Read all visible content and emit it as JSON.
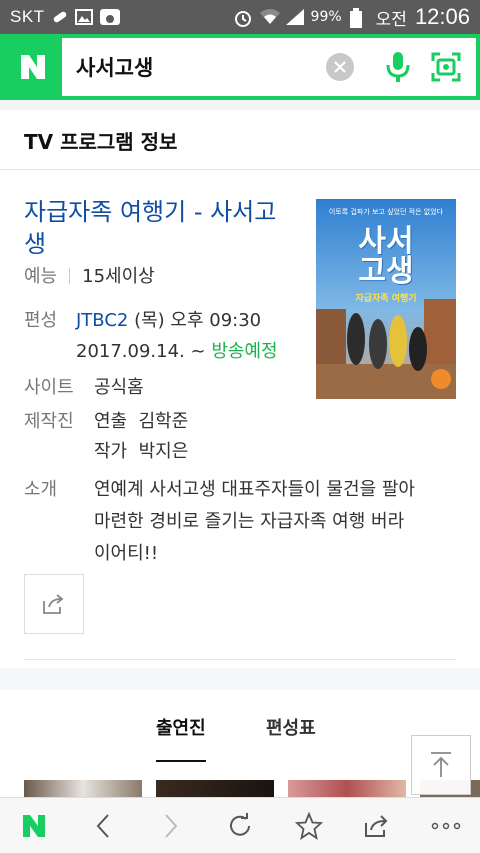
{
  "status_bar": {
    "carrier": "SKT",
    "battery": "99%",
    "ampm": "오전",
    "time": "12:06"
  },
  "search": {
    "query": "사서고생",
    "brand_color": "#19ce60"
  },
  "section": {
    "title": "TV 프로그램 정보"
  },
  "program": {
    "title": "자급자족 여행기 - 사서고생",
    "genre": "예능",
    "rating": "15세이상",
    "schedule_label": "편성",
    "channel": "JTBC2",
    "schedule_time": "(목) 오후 09:30",
    "start_date": "2017.09.14. ~",
    "status": "방송예정",
    "site_label": "사이트",
    "site_link": "공식홈",
    "crew_label": "제작진",
    "director_role": "연출",
    "director_name": "김학준",
    "writer_role": "작가",
    "writer_name": "박지은",
    "intro_label": "소개",
    "intro_line1": "연예계 사서고생 대표주자들이 물건을 팔아",
    "intro_line2": "마련한 경비로 즐기는 자급자족 여행 버라",
    "intro_line3": "이어티!!",
    "poster_tagline": "이토록 겁파가 보고 싶었던 적은 없었다",
    "poster_title_1": "사서",
    "poster_title_2": "고생",
    "poster_subtitle": "자급자족 여행기"
  },
  "tabs": {
    "cast": "출연진",
    "schedule": "편성표"
  },
  "icons": {
    "share": "share-icon",
    "scroll_top": "arrow-up-to-line-icon",
    "mic": "microphone-icon",
    "lens": "lens-icon",
    "clear": "clear-icon"
  },
  "colors": {
    "link": "#0f4ea3",
    "status": "#18b44e"
  }
}
